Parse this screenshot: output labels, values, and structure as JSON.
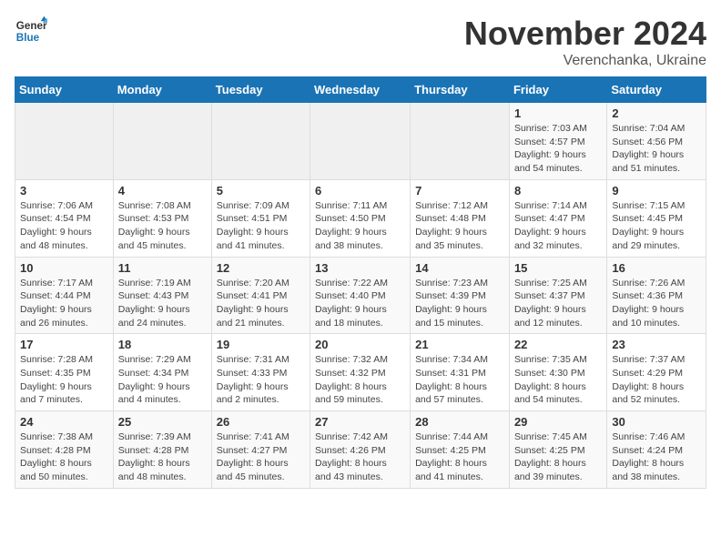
{
  "logo": {
    "line1": "General",
    "line2": "Blue"
  },
  "title": "November 2024",
  "subtitle": "Verenchanka, Ukraine",
  "weekdays": [
    "Sunday",
    "Monday",
    "Tuesday",
    "Wednesday",
    "Thursday",
    "Friday",
    "Saturday"
  ],
  "weeks": [
    [
      {
        "day": "",
        "info": ""
      },
      {
        "day": "",
        "info": ""
      },
      {
        "day": "",
        "info": ""
      },
      {
        "day": "",
        "info": ""
      },
      {
        "day": "",
        "info": ""
      },
      {
        "day": "1",
        "info": "Sunrise: 7:03 AM\nSunset: 4:57 PM\nDaylight: 9 hours and 54 minutes."
      },
      {
        "day": "2",
        "info": "Sunrise: 7:04 AM\nSunset: 4:56 PM\nDaylight: 9 hours and 51 minutes."
      }
    ],
    [
      {
        "day": "3",
        "info": "Sunrise: 7:06 AM\nSunset: 4:54 PM\nDaylight: 9 hours and 48 minutes."
      },
      {
        "day": "4",
        "info": "Sunrise: 7:08 AM\nSunset: 4:53 PM\nDaylight: 9 hours and 45 minutes."
      },
      {
        "day": "5",
        "info": "Sunrise: 7:09 AM\nSunset: 4:51 PM\nDaylight: 9 hours and 41 minutes."
      },
      {
        "day": "6",
        "info": "Sunrise: 7:11 AM\nSunset: 4:50 PM\nDaylight: 9 hours and 38 minutes."
      },
      {
        "day": "7",
        "info": "Sunrise: 7:12 AM\nSunset: 4:48 PM\nDaylight: 9 hours and 35 minutes."
      },
      {
        "day": "8",
        "info": "Sunrise: 7:14 AM\nSunset: 4:47 PM\nDaylight: 9 hours and 32 minutes."
      },
      {
        "day": "9",
        "info": "Sunrise: 7:15 AM\nSunset: 4:45 PM\nDaylight: 9 hours and 29 minutes."
      }
    ],
    [
      {
        "day": "10",
        "info": "Sunrise: 7:17 AM\nSunset: 4:44 PM\nDaylight: 9 hours and 26 minutes."
      },
      {
        "day": "11",
        "info": "Sunrise: 7:19 AM\nSunset: 4:43 PM\nDaylight: 9 hours and 24 minutes."
      },
      {
        "day": "12",
        "info": "Sunrise: 7:20 AM\nSunset: 4:41 PM\nDaylight: 9 hours and 21 minutes."
      },
      {
        "day": "13",
        "info": "Sunrise: 7:22 AM\nSunset: 4:40 PM\nDaylight: 9 hours and 18 minutes."
      },
      {
        "day": "14",
        "info": "Sunrise: 7:23 AM\nSunset: 4:39 PM\nDaylight: 9 hours and 15 minutes."
      },
      {
        "day": "15",
        "info": "Sunrise: 7:25 AM\nSunset: 4:37 PM\nDaylight: 9 hours and 12 minutes."
      },
      {
        "day": "16",
        "info": "Sunrise: 7:26 AM\nSunset: 4:36 PM\nDaylight: 9 hours and 10 minutes."
      }
    ],
    [
      {
        "day": "17",
        "info": "Sunrise: 7:28 AM\nSunset: 4:35 PM\nDaylight: 9 hours and 7 minutes."
      },
      {
        "day": "18",
        "info": "Sunrise: 7:29 AM\nSunset: 4:34 PM\nDaylight: 9 hours and 4 minutes."
      },
      {
        "day": "19",
        "info": "Sunrise: 7:31 AM\nSunset: 4:33 PM\nDaylight: 9 hours and 2 minutes."
      },
      {
        "day": "20",
        "info": "Sunrise: 7:32 AM\nSunset: 4:32 PM\nDaylight: 8 hours and 59 minutes."
      },
      {
        "day": "21",
        "info": "Sunrise: 7:34 AM\nSunset: 4:31 PM\nDaylight: 8 hours and 57 minutes."
      },
      {
        "day": "22",
        "info": "Sunrise: 7:35 AM\nSunset: 4:30 PM\nDaylight: 8 hours and 54 minutes."
      },
      {
        "day": "23",
        "info": "Sunrise: 7:37 AM\nSunset: 4:29 PM\nDaylight: 8 hours and 52 minutes."
      }
    ],
    [
      {
        "day": "24",
        "info": "Sunrise: 7:38 AM\nSunset: 4:28 PM\nDaylight: 8 hours and 50 minutes."
      },
      {
        "day": "25",
        "info": "Sunrise: 7:39 AM\nSunset: 4:28 PM\nDaylight: 8 hours and 48 minutes."
      },
      {
        "day": "26",
        "info": "Sunrise: 7:41 AM\nSunset: 4:27 PM\nDaylight: 8 hours and 45 minutes."
      },
      {
        "day": "27",
        "info": "Sunrise: 7:42 AM\nSunset: 4:26 PM\nDaylight: 8 hours and 43 minutes."
      },
      {
        "day": "28",
        "info": "Sunrise: 7:44 AM\nSunset: 4:25 PM\nDaylight: 8 hours and 41 minutes."
      },
      {
        "day": "29",
        "info": "Sunrise: 7:45 AM\nSunset: 4:25 PM\nDaylight: 8 hours and 39 minutes."
      },
      {
        "day": "30",
        "info": "Sunrise: 7:46 AM\nSunset: 4:24 PM\nDaylight: 8 hours and 38 minutes."
      }
    ]
  ]
}
